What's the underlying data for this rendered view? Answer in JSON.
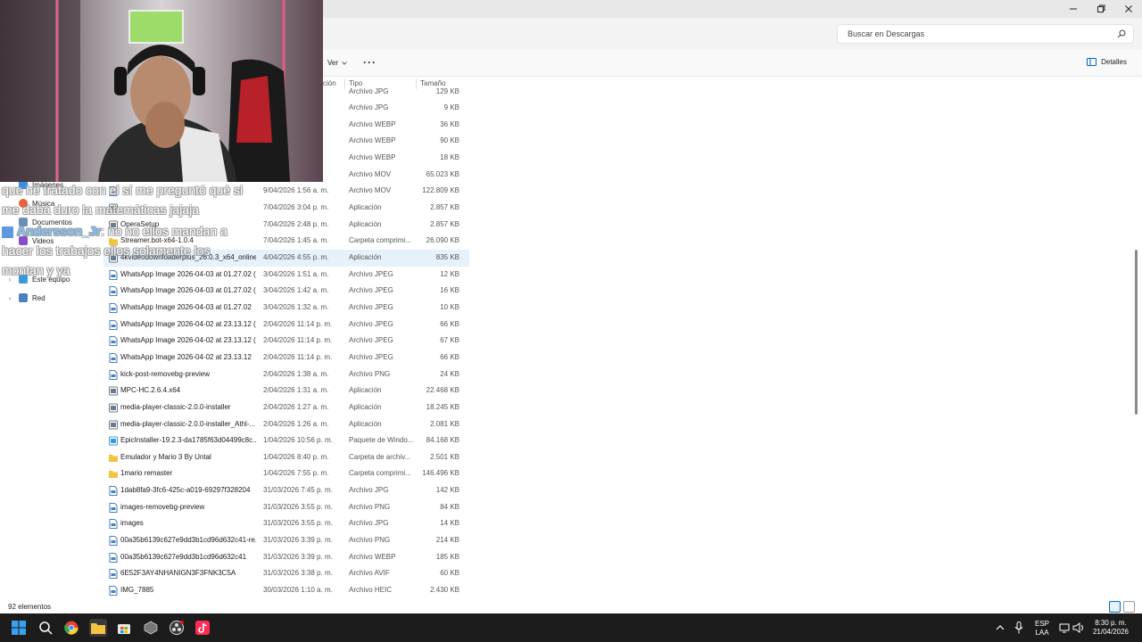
{
  "search": {
    "placeholder": "Buscar en Descargas"
  },
  "command_bar": {
    "view_label": "Ver",
    "more_label": "···",
    "details_label": "Detalles"
  },
  "columns": {
    "modified_partial": "ción",
    "type": "Tipo",
    "size": "Tamaño"
  },
  "nav": {
    "items": [
      {
        "label": "Imágenes"
      },
      {
        "label": "Música"
      },
      {
        "label": "Documentos"
      },
      {
        "label": "Videos"
      },
      {
        "label": "Este equipo"
      },
      {
        "label": "Red"
      }
    ]
  },
  "files": [
    {
      "name": "",
      "date": "",
      "type": "Archivo JPG",
      "size": "129 KB"
    },
    {
      "name": "",
      "date": "",
      "type": "Archivo JPG",
      "size": "9 KB"
    },
    {
      "name": "",
      "date": "",
      "type": "Archivo WEBP",
      "size": "36 KB"
    },
    {
      "name": "",
      "date": "",
      "type": "Archivo WEBP",
      "size": "90 KB"
    },
    {
      "name": "",
      "date": "",
      "type": "Archivo WEBP",
      "size": "18 KB"
    },
    {
      "name": "",
      "date": "",
      "type": "Archivo MOV",
      "size": "65.023 KB"
    },
    {
      "name": "",
      "date": "9/04/2026 1:56 a. m.",
      "type": "Archivo MOV",
      "size": "122.809 KB"
    },
    {
      "name": "",
      "date": "7/04/2026 3:04 p. m.",
      "type": "Aplicación",
      "size": "2.857 KB"
    },
    {
      "name": "OperaSetup",
      "date": "7/04/2026 2:48 p. m.",
      "type": "Aplicación",
      "size": "2.857 KB"
    },
    {
      "name": "Streamer.bot-x64-1.0.4",
      "date": "7/04/2026 1:45 a. m.",
      "type": "Carpeta comprimi...",
      "size": "26.090 KB"
    },
    {
      "name": "4kvideodownloaderplus_26.0.3_x64_online",
      "date": "4/04/2026 4:55 p. m.",
      "type": "Aplicación",
      "size": "835 KB"
    },
    {
      "name": "WhatsApp Image 2026-04-03 at 01.27.02 (...",
      "date": "3/04/2026 1:51 a. m.",
      "type": "Archivo JPEG",
      "size": "12 KB"
    },
    {
      "name": "WhatsApp Image 2026-04-03 at 01.27.02 (...",
      "date": "3/04/2026 1:42 a. m.",
      "type": "Archivo JPEG",
      "size": "16 KB"
    },
    {
      "name": "WhatsApp Image 2026-04-03 at 01.27.02",
      "date": "3/04/2026 1:32 a. m.",
      "type": "Archivo JPEG",
      "size": "10 KB"
    },
    {
      "name": "WhatsApp Image 2026-04-02 at 23.13.12 (...",
      "date": "2/04/2026 11:14 p. m.",
      "type": "Archivo JPEG",
      "size": "66 KB"
    },
    {
      "name": "WhatsApp Image 2026-04-02 at 23.13.12 (...",
      "date": "2/04/2026 11:14 p. m.",
      "type": "Archivo JPEG",
      "size": "67 KB"
    },
    {
      "name": "WhatsApp Image 2026-04-02 at 23.13.12",
      "date": "2/04/2026 11:14 p. m.",
      "type": "Archivo JPEG",
      "size": "66 KB"
    },
    {
      "name": "kick-post-removebg-preview",
      "date": "2/04/2026 1:38 a. m.",
      "type": "Archivo PNG",
      "size": "24 KB"
    },
    {
      "name": "MPC-HC.2.6.4.x64",
      "date": "2/04/2026 1:31 a. m.",
      "type": "Aplicación",
      "size": "22.468 KB"
    },
    {
      "name": "media-player-classic-2.0.0-installer",
      "date": "2/04/2026 1:27 a. m.",
      "type": "Aplicación",
      "size": "18.245 KB"
    },
    {
      "name": "media-player-classic-2.0.0-installer_Athl-...",
      "date": "2/04/2026 1:26 a. m.",
      "type": "Aplicación",
      "size": "2.081 KB"
    },
    {
      "name": "EpicInstaller-19.2.3-da1785f63d04499c8c...",
      "date": "1/04/2026 10:56 p. m.",
      "type": "Paquete de Windo...",
      "size": "84.168 KB"
    },
    {
      "name": "Emulador y Mario 3 By Untal",
      "date": "1/04/2026 8:40 p. m.",
      "type": "Carpeta de archiv...",
      "size": "2.501 KB"
    },
    {
      "name": "1mario remaster",
      "date": "1/04/2026 7:55 p. m.",
      "type": "Carpeta comprimi...",
      "size": "146.496 KB"
    },
    {
      "name": "1dab8fa9-3fc6-425c-a019-69297f328204",
      "date": "31/03/2026 7:45 p. m.",
      "type": "Archivo JPG",
      "size": "142 KB"
    },
    {
      "name": "images-removebg-preview",
      "date": "31/03/2026 3:55 p. m.",
      "type": "Archivo PNG",
      "size": "84 KB"
    },
    {
      "name": "images",
      "date": "31/03/2026 3:55 p. m.",
      "type": "Archivo JPG",
      "size": "14 KB"
    },
    {
      "name": "00a35b6139c627e9dd3b1cd96d632c41-re...",
      "date": "31/03/2026 3:39 p. m.",
      "type": "Archivo PNG",
      "size": "214 KB"
    },
    {
      "name": "00a35b6139c627e9dd3b1cd96d632c41",
      "date": "31/03/2026 3:39 p. m.",
      "type": "Archivo WEBP",
      "size": "185 KB"
    },
    {
      "name": "6E52F3AY4NHANIGN3F3FNK3C5A",
      "date": "31/03/2026 3:38 p. m.",
      "type": "Archivo AVIF",
      "size": "60 KB"
    },
    {
      "name": "IMG_7885",
      "date": "30/03/2026 1:10 a. m.",
      "type": "Archivo HEIC",
      "size": "2.430 KB"
    }
  ],
  "status": {
    "count": "92 elementos"
  },
  "chat": {
    "line1": "que he tratado con el sí me preguntó qué si",
    "line2": "me daba duro la matemáticas jajaja",
    "user": "Andersson_Jr",
    "line3": ": no no ellos mandan a",
    "line4": "hacer los trabajos ellos solamente los",
    "line5": "montan y ya"
  },
  "taskbar": {
    "lang_top": "ESP",
    "lang_bottom": "LAA",
    "time": "8:30 p. m.",
    "date": "21/04/2026"
  },
  "colors": {
    "accent": "#0067c0",
    "selected_row": "#e5f1fb",
    "taskbar": "#1c1c1c",
    "chat_user": "#64b7ff"
  }
}
